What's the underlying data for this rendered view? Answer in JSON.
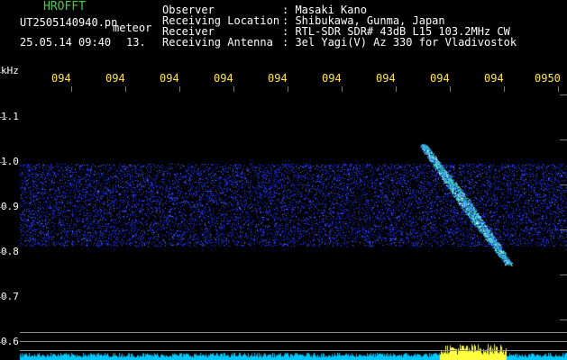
{
  "app": {
    "title": "HROFFT"
  },
  "file": {
    "name": "UT2505140940.pn",
    "tag": "meteor",
    "datetime": "25.05.14 09:40",
    "count": "13."
  },
  "info": {
    "labels": [
      "Observer",
      "Receiving Location",
      "Receiver",
      "Receiving Antenna"
    ],
    "values": [
      ": Masaki Kano",
      ": Shibukawa, Gunma, Japan",
      ": RTL-SDR SDR# 43dB L15 103.2MHz CW",
      ": 3el Yagi(V) Az 330 for Vladivostok"
    ]
  },
  "axes": {
    "y_unit": "kHz",
    "y_ticks": [
      "1.1",
      "1.0",
      "0.9",
      "0.8",
      "0.7",
      "0.6"
    ],
    "x_ticks": [
      "094",
      "094",
      "094",
      "094",
      "094",
      "094",
      "094",
      "094",
      "094",
      "0950"
    ]
  },
  "colors": {
    "noise": "#2a3cff",
    "echo": "#40d8c0",
    "baseline": "#00c8ff",
    "burst": "#ffff40",
    "title": "#3cd23c",
    "tick_labels": "#ffe640"
  }
}
